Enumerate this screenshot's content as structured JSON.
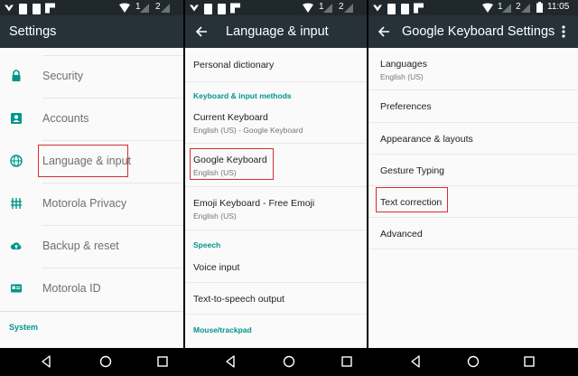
{
  "status_bar": {
    "clock": "11:05",
    "sim1": "1",
    "sim2": "2"
  },
  "settings_screen": {
    "title": "Settings",
    "items": [
      {
        "label": "Security",
        "icon": "lock-icon"
      },
      {
        "label": "Accounts",
        "icon": "account-box-icon"
      },
      {
        "label": "Language & input",
        "icon": "globe-icon"
      },
      {
        "label": "Motorola Privacy",
        "icon": "privacy-icon"
      },
      {
        "label": "Backup & reset",
        "icon": "cloud-upload-icon"
      },
      {
        "label": "Motorola ID",
        "icon": "id-card-icon"
      }
    ],
    "section_system": "System"
  },
  "language_screen": {
    "title": "Language & input",
    "personal_dictionary": "Personal dictionary",
    "category_keyboard": "Keyboard & input methods",
    "current_keyboard": {
      "title": "Current Keyboard",
      "subtitle": "English (US) - Google Keyboard"
    },
    "google_keyboard": {
      "title": "Google Keyboard",
      "subtitle": "English (US)"
    },
    "emoji_keyboard": {
      "title": "Emoji Keyboard - Free Emoji",
      "subtitle": "English (US)"
    },
    "category_speech": "Speech",
    "voice_input": "Voice input",
    "tts_output": "Text-to-speech output",
    "category_mouse": "Mouse/trackpad"
  },
  "keyboard_screen": {
    "title": "Google Keyboard Settings",
    "languages": {
      "title": "Languages",
      "subtitle": "English (US)"
    },
    "items": [
      "Preferences",
      "Appearance & layouts",
      "Gesture Typing",
      "Text correction",
      "Advanced"
    ]
  },
  "colors": {
    "app_bar": "#263238",
    "accent": "#009688",
    "highlight": "#d32f2f"
  }
}
